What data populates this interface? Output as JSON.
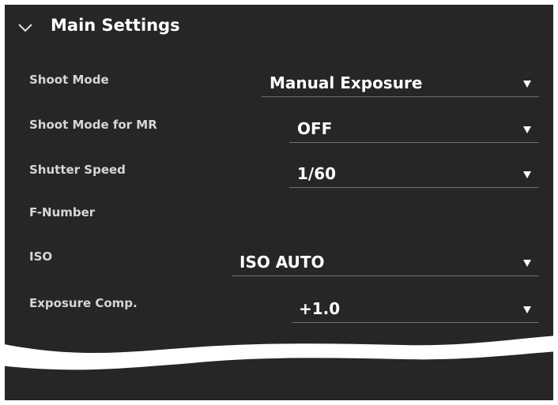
{
  "section": {
    "title": "Main Settings",
    "expanded_icon": "chevron-down-icon"
  },
  "rows": {
    "shoot_mode": {
      "label": "Shoot Mode",
      "value": "Manual Exposure"
    },
    "shoot_mode_mr": {
      "label": "Shoot Mode for MR",
      "value": "OFF"
    },
    "shutter_speed": {
      "label": "Shutter Speed",
      "value": "1/60"
    },
    "f_number": {
      "label": "F-Number"
    },
    "iso": {
      "label": "ISO",
      "value": "ISO AUTO"
    },
    "exposure_comp": {
      "label": "Exposure Comp.",
      "value": "+1.0"
    }
  },
  "colors": {
    "panel_bg": "#262626",
    "label_text": "#d6d6d6",
    "value_text": "#ffffff",
    "underline": "#707070"
  }
}
